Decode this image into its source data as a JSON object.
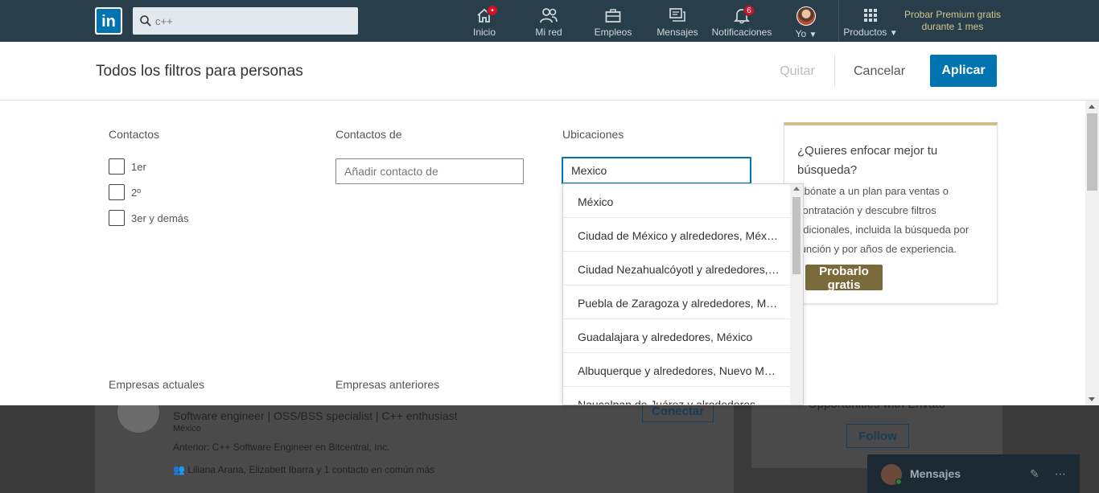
{
  "nav": {
    "logo": "in",
    "search_value": "c++",
    "items": [
      {
        "label": "Inicio",
        "badge": "•"
      },
      {
        "label": "Mi red",
        "badge": ""
      },
      {
        "label": "Empleos",
        "badge": ""
      },
      {
        "label": "Mensajes",
        "badge": ""
      },
      {
        "label": "Notificaciones",
        "badge": "6"
      },
      {
        "label": "Yo",
        "badge": ""
      },
      {
        "label": "Productos",
        "badge": ""
      }
    ],
    "premium_line1": "Probar Premium gratis",
    "premium_line2": "durante 1 mes"
  },
  "filters": {
    "title": "Todos los filtros para personas",
    "quitar": "Quitar",
    "cancelar": "Cancelar",
    "aplicar": "Aplicar",
    "contactos": {
      "label": "Contactos",
      "options": [
        "1er",
        "2º",
        "3er y demás"
      ]
    },
    "contactos_de": {
      "label": "Contactos de",
      "placeholder": "Añadir contacto de"
    },
    "ubicaciones": {
      "label": "Ubicaciones",
      "value": "Mexico",
      "suggestions": [
        "México",
        "Ciudad de México y alrededores, México",
        "Ciudad Nezahualcóyotl y alrededores, México",
        "Puebla de Zaragoza y alrededores, México",
        "Guadalajara y alrededores, México",
        "Albuquerque y alrededores, Nuevo México",
        "Naucalpan de Juárez y alrededores, México"
      ]
    },
    "empresas_actuales": "Empresas actuales",
    "empresas_anteriores": "Empresas anteriores"
  },
  "premium_card": {
    "title": "¿Quieres enfocar mejor tu búsqueda?",
    "body": "Abónate a un plan para ventas o contratación y descubre filtros adicionales, incluida la búsqueda por función y por años de experiencia.",
    "button": "Probarlo gratis"
  },
  "background": {
    "headline": "Software engineer | OSS/BSS specialist | C++ enthusiast",
    "location": "México",
    "previous": "Anterior: C++ Software Engineer en Bitcentral, Inc.",
    "shared": "Liliana Arana, Elizabett Ibarra y 1 contacto en común más",
    "connect": "Conectar",
    "right_title": "Opportunities with Envato",
    "follow": "Follow",
    "messages": "Mensajes"
  }
}
